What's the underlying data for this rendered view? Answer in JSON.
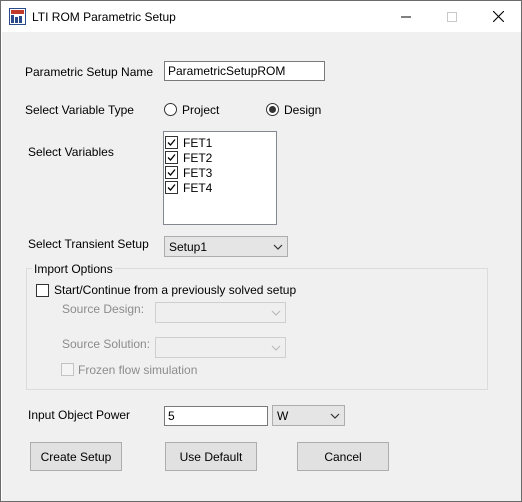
{
  "window": {
    "title": "LTI ROM Parametric Setup",
    "minimize_icon": "minimize-icon",
    "maximize_icon": "maximize-icon",
    "close_icon": "close-icon"
  },
  "setup_name": {
    "label": "Parametric Setup Name",
    "value": "ParametricSetupROM"
  },
  "variable_type": {
    "label": "Select Variable Type",
    "options": [
      "Project",
      "Design"
    ],
    "selected": "Design"
  },
  "variables": {
    "label": "Select Variables",
    "items": [
      {
        "label": "FET1",
        "checked": true
      },
      {
        "label": "FET2",
        "checked": true
      },
      {
        "label": "FET3",
        "checked": true
      },
      {
        "label": "FET4",
        "checked": true
      }
    ]
  },
  "transient_setup": {
    "label": "Select Transient Setup",
    "value": "Setup1"
  },
  "import_options": {
    "title": "Import Options",
    "continue_label": "Start/Continue from a previously solved setup",
    "continue_checked": false,
    "source_design_label": "Source Design:",
    "source_design_value": "",
    "source_solution_label": "Source Solution:",
    "source_solution_value": "",
    "frozen_flow_label": "Frozen flow simulation",
    "frozen_flow_checked": false
  },
  "power": {
    "label": "Input Object Power",
    "value": "5",
    "unit": "W"
  },
  "buttons": {
    "create": "Create Setup",
    "default": "Use Default",
    "cancel": "Cancel"
  }
}
